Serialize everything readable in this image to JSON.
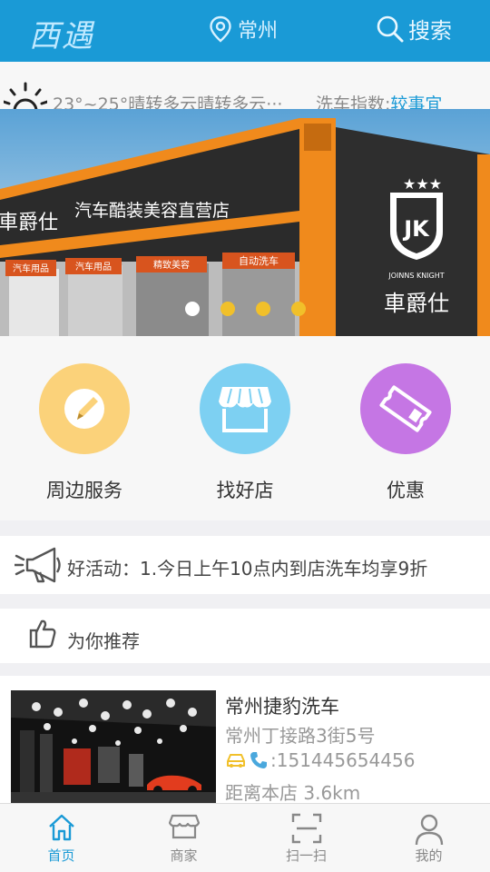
{
  "header": {
    "logo": "西遇",
    "location": "常州",
    "search_label": "搜索"
  },
  "weather": {
    "text": "23°~25°晴转多云晴转多云···",
    "index_label": "洗车指数:",
    "index_value": "较事宜"
  },
  "banner": {
    "sign_main": "汽车酷装美容直营店",
    "sign_brand": "車爵仕",
    "sign_jk": "JK",
    "sign_knight": "JOINNS KNIGHT",
    "sign_left": "車爵仕",
    "shop_signs": [
      "汽车用品",
      "汽车用品",
      "精致美容",
      "自动洗车"
    ],
    "slides": 4,
    "active_slide": 1
  },
  "categories": [
    {
      "label": "周边服务",
      "icon": "pencil-icon",
      "color": "#fbd27a"
    },
    {
      "label": "找好店",
      "icon": "storefront-icon",
      "color": "#7dd0f2"
    },
    {
      "label": "优惠",
      "icon": "ticket-icon",
      "color": "#c576e4"
    }
  ],
  "activity": {
    "text": "好活动：1.今日上午10点内到店洗车均享9折"
  },
  "recommend": {
    "title": "为你推荐"
  },
  "shop": {
    "name": "常州捷豹洗车",
    "address": "常州丁接路3街5号",
    "phone": ":151445654456",
    "distance": "距离本店 3.6km"
  },
  "tabs": [
    {
      "label": "首页",
      "icon": "home-icon",
      "active": true
    },
    {
      "label": "商家",
      "icon": "shop-icon",
      "active": false
    },
    {
      "label": "扫一扫",
      "icon": "scan-icon",
      "active": false
    },
    {
      "label": "我的",
      "icon": "user-icon",
      "active": false
    }
  ],
  "colors": {
    "primary": "#1a9ad6",
    "accent_orange": "#f39a1e",
    "accent_yellow": "#f1c02a"
  }
}
